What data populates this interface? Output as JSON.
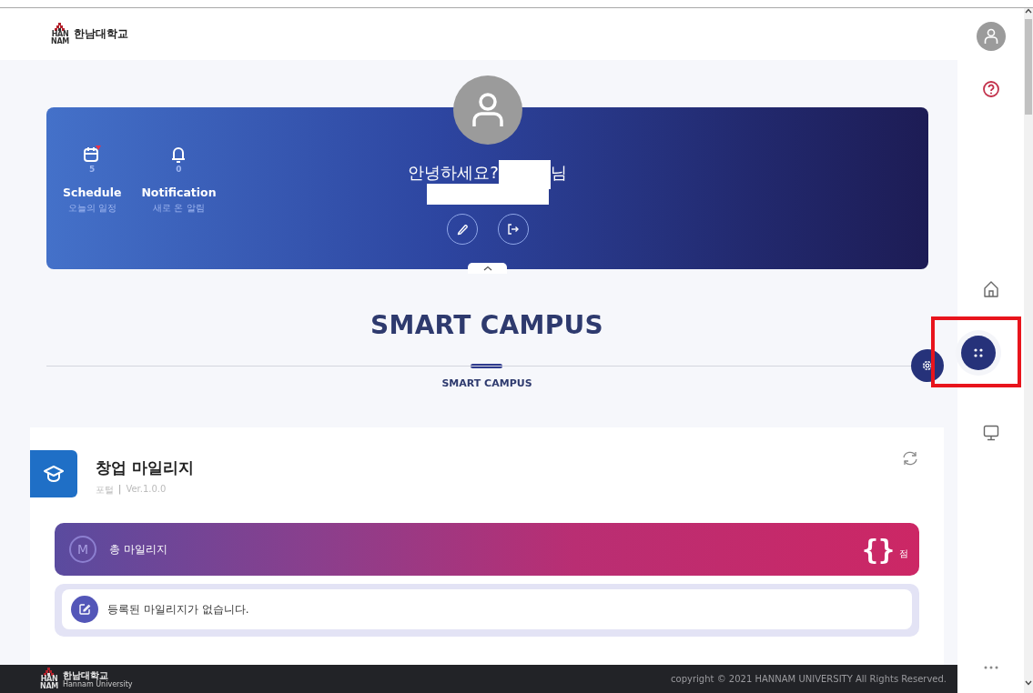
{
  "header": {
    "logo_mark": [
      "HAN",
      "NAM"
    ],
    "logo_text": "한남대학교"
  },
  "banner": {
    "stats": [
      {
        "kind": "schedule",
        "count": "5",
        "label": "Schedule",
        "sublabel": "오늘의 일정",
        "alert": true
      },
      {
        "kind": "notification",
        "count": "0",
        "label": "Notification",
        "sublabel": "새로 온 알림",
        "alert": false
      }
    ],
    "greeting": "안녕하세요?",
    "honorific": "님",
    "name_redacted": true,
    "actions": [
      {
        "kind": "edit"
      },
      {
        "kind": "logout"
      }
    ]
  },
  "section": {
    "title": "SMART CAMPUS",
    "tabs": [
      {
        "label": "SMART CAMPUS",
        "selected": true
      }
    ]
  },
  "widget": {
    "title": "창업 마일리지",
    "category": "포털",
    "separator": "|",
    "version": "Ver.1.0.0",
    "total_badge": "M",
    "total_label": "총 마일리지",
    "total_value": "{}",
    "total_unit": "점",
    "empty_message": "등록된 마일리지가 없습니다."
  },
  "sidebar": {
    "items": [
      {
        "kind": "profile",
        "selected": false
      },
      {
        "kind": "help",
        "selected": false
      },
      {
        "kind": "home",
        "selected": false
      },
      {
        "kind": "apps",
        "selected": true,
        "highlighted": true
      },
      {
        "kind": "monitor",
        "selected": false
      },
      {
        "kind": "more",
        "selected": false
      }
    ]
  },
  "footer": {
    "logo_mark": [
      "HAN",
      "NAM"
    ],
    "logo_text": "한남대학교",
    "logo_subtext": "Hannam University",
    "copyright": "copyright © 2021 HANNAM UNIVERSITY All Rights Reserved."
  }
}
